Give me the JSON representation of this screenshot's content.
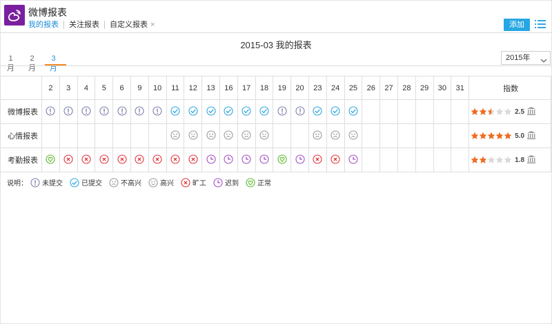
{
  "header": {
    "app_title": "微博报表",
    "subtabs": [
      {
        "label": "我的报表",
        "active": true,
        "closable": false
      },
      {
        "label": "关注报表",
        "active": false,
        "closable": false
      },
      {
        "label": "自定义报表",
        "active": false,
        "closable": true
      }
    ],
    "close_glyph": "×",
    "add_label": "添加"
  },
  "report_title": "2015-03 我的报表",
  "months": [
    {
      "label": "1月",
      "active": false
    },
    {
      "label": "2月",
      "active": false
    },
    {
      "label": "3月",
      "active": true
    }
  ],
  "year_select": {
    "value": "2015年"
  },
  "table": {
    "days": [
      "2",
      "3",
      "4",
      "5",
      "6",
      "9",
      "10",
      "11",
      "12",
      "13",
      "16",
      "17",
      "18",
      "19",
      "20",
      "23",
      "24",
      "25",
      "26",
      "27",
      "28",
      "29",
      "30",
      "31"
    ],
    "score_header": "指数",
    "rows": [
      {
        "label": "微博报表",
        "cells": [
          "unsubmitted",
          "unsubmitted",
          "unsubmitted",
          "unsubmitted",
          "unsubmitted",
          "unsubmitted",
          "unsubmitted",
          "submitted",
          "submitted",
          "submitted",
          "submitted",
          "submitted",
          "submitted",
          "unsubmitted",
          "unsubmitted",
          "submitted",
          "submitted",
          "submitted",
          "",
          "",
          "",
          "",
          "",
          ""
        ],
        "rating": 2.5,
        "score": "2.5"
      },
      {
        "label": "心情报表",
        "cells": [
          "",
          "",
          "",
          "",
          "",
          "",
          "",
          "unhappy",
          "unhappy",
          "unhappy",
          "unhappy",
          "unhappy",
          "unhappy",
          "",
          "",
          "unhappy",
          "unhappy",
          "unhappy",
          "",
          "",
          "",
          "",
          "",
          ""
        ],
        "rating": 5.0,
        "score": "5.0"
      },
      {
        "label": "考勤报表",
        "cells": [
          "normal",
          "absent",
          "absent",
          "absent",
          "absent",
          "absent",
          "absent",
          "absent",
          "absent",
          "late",
          "late",
          "late",
          "late",
          "normal",
          "late",
          "absent",
          "absent",
          "late",
          "",
          "",
          "",
          "",
          "",
          ""
        ],
        "rating": 1.8,
        "score": "1.8"
      }
    ]
  },
  "legend": {
    "title": "说明：",
    "items": [
      {
        "icon": "unsubmitted",
        "label": "未提交"
      },
      {
        "icon": "submitted",
        "label": "已提交"
      },
      {
        "icon": "unhappy",
        "label": "不高兴"
      },
      {
        "icon": "happy",
        "label": "高兴"
      },
      {
        "icon": "absent",
        "label": "旷工"
      },
      {
        "icon": "late",
        "label": "迟到"
      },
      {
        "icon": "normal",
        "label": "正常"
      }
    ]
  },
  "colors": {
    "accent": "#26a7e3",
    "logo_bg": "#7a1fa0",
    "tab_active": "#1e8fd8",
    "tab_underline": "#f08a24",
    "star": "#f06a1e",
    "star_empty": "#d8d8d8",
    "unsubmitted": "#7a7fa8",
    "submitted": "#2ea6e0",
    "mood": "#999999",
    "absent": "#e0343c",
    "late": "#a24fc4",
    "normal": "#5cb82e"
  }
}
